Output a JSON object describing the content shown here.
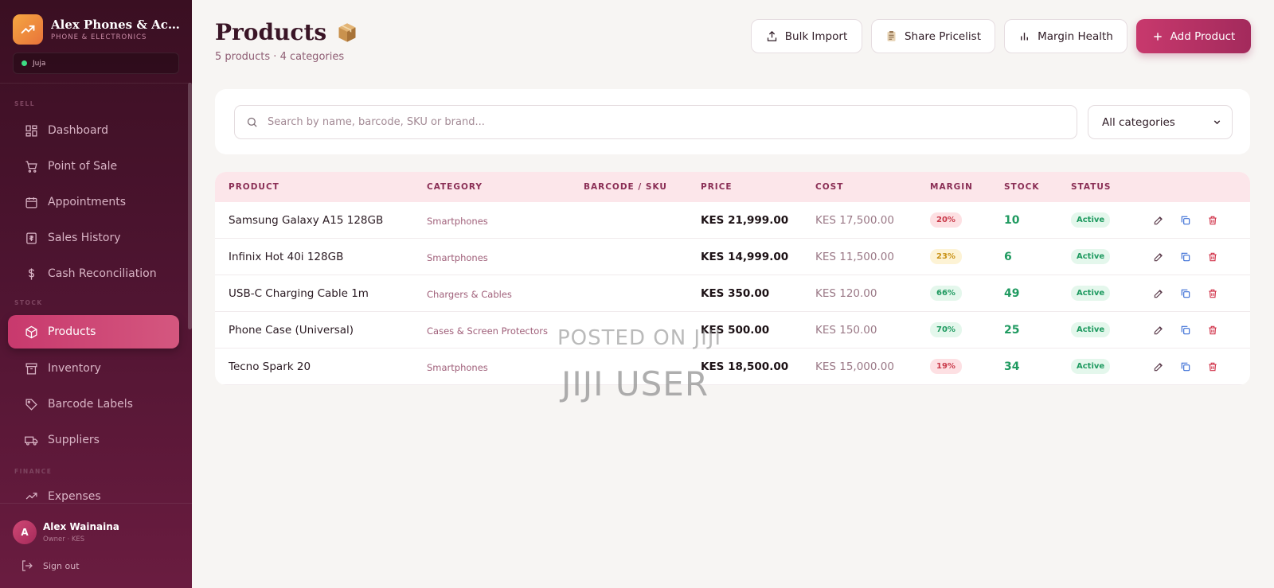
{
  "brand": {
    "name": "Alex Phones & Accessories",
    "subtitle": "PHONE & ELECTRONICS"
  },
  "branch": {
    "label": "Juja",
    "status_color": "#3ddc84"
  },
  "sidebar": {
    "sections": {
      "sell": "SELL",
      "stock": "STOCK",
      "finance": "FINANCE"
    },
    "items": [
      {
        "label": "Dashboard",
        "icon": "dashboard-icon"
      },
      {
        "label": "Point of Sale",
        "icon": "cart-icon"
      },
      {
        "label": "Appointments",
        "icon": "calendar-icon"
      },
      {
        "label": "Sales History",
        "icon": "receipt-icon"
      },
      {
        "label": "Cash Reconciliation",
        "icon": "dollar-icon"
      },
      {
        "label": "Products",
        "icon": "box-icon",
        "active": true
      },
      {
        "label": "Inventory",
        "icon": "archive-icon"
      },
      {
        "label": "Barcode Labels",
        "icon": "tag-icon"
      },
      {
        "label": "Suppliers",
        "icon": "truck-icon"
      },
      {
        "label": "Expenses",
        "icon": "trend-icon"
      }
    ]
  },
  "user": {
    "initial": "A",
    "name": "Alex Wainaina",
    "role": "Owner · KES",
    "signout": "Sign out"
  },
  "header": {
    "title": "Products",
    "subtitle": "5 products · 4 categories"
  },
  "toolbar": {
    "bulk_import": "Bulk Import",
    "share_pricelist": "Share Pricelist",
    "margin_health": "Margin Health",
    "add_product": "Add Product"
  },
  "search": {
    "placeholder": "Search by name, barcode, SKU or brand...",
    "category": "All categories"
  },
  "table": {
    "headers": [
      "PRODUCT",
      "CATEGORY",
      "BARCODE / SKU",
      "PRICE",
      "COST",
      "MARGIN",
      "STOCK",
      "STATUS"
    ],
    "rows": [
      {
        "name": "Samsung Galaxy A15 128GB",
        "category": "Smartphones",
        "sku": "",
        "price": "KES 21,999.00",
        "cost": "KES 17,500.00",
        "margin": "20%",
        "margin_level": "red",
        "stock": "10",
        "status": "Active"
      },
      {
        "name": "Infinix Hot 40i 128GB",
        "category": "Smartphones",
        "sku": "",
        "price": "KES 14,999.00",
        "cost": "KES 11,500.00",
        "margin": "23%",
        "margin_level": "yellow",
        "stock": "6",
        "status": "Active"
      },
      {
        "name": "USB-C Charging Cable 1m",
        "category": "Chargers & Cables",
        "sku": "",
        "price": "KES 350.00",
        "cost": "KES 120.00",
        "margin": "66%",
        "margin_level": "green",
        "stock": "49",
        "status": "Active"
      },
      {
        "name": "Phone Case (Universal)",
        "category": "Cases & Screen Protectors",
        "sku": "",
        "price": "KES 500.00",
        "cost": "KES 150.00",
        "margin": "70%",
        "margin_level": "green",
        "stock": "25",
        "status": "Active"
      },
      {
        "name": "Tecno Spark 20",
        "category": "Smartphones",
        "sku": "",
        "price": "KES 18,500.00",
        "cost": "KES 15,000.00",
        "margin": "19%",
        "margin_level": "red",
        "stock": "34",
        "status": "Active"
      }
    ]
  },
  "watermark": {
    "line1": "POSTED ON JIJI",
    "line2": "JIJI USER"
  },
  "colors": {
    "accent": "#c8396d",
    "sidebar": "#4d1430",
    "success": "#1f9a60"
  }
}
